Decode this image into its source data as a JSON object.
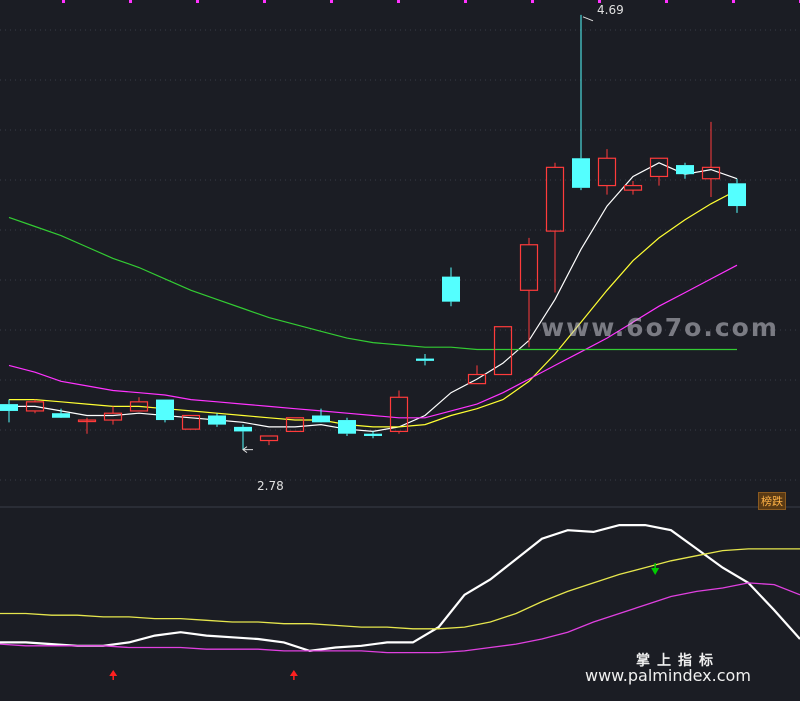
{
  "chart_data": [
    {
      "type": "candlestick",
      "title": "",
      "ylim": [
        2.55,
        4.72
      ],
      "grid": true,
      "annotations": {
        "high_label": "4.69",
        "low_label": "2.78"
      },
      "candles": [
        {
          "o": 2.98,
          "h": 3.0,
          "l": 2.9,
          "c": 2.95
        },
        {
          "o": 2.95,
          "h": 3.0,
          "l": 2.94,
          "c": 2.99
        },
        {
          "o": 2.94,
          "h": 2.96,
          "l": 2.93,
          "c": 2.92
        },
        {
          "o": 2.91,
          "h": 2.92,
          "l": 2.85,
          "c": 2.91
        },
        {
          "o": 2.91,
          "h": 2.97,
          "l": 2.89,
          "c": 2.94
        },
        {
          "o": 2.95,
          "h": 3.01,
          "l": 2.95,
          "c": 2.99
        },
        {
          "o": 3.0,
          "h": 3.0,
          "l": 2.9,
          "c": 2.91
        },
        {
          "o": 2.87,
          "h": 2.93,
          "l": 2.87,
          "c": 2.93
        },
        {
          "o": 2.93,
          "h": 2.94,
          "l": 2.88,
          "c": 2.89
        },
        {
          "o": 2.88,
          "h": 2.89,
          "l": 2.78,
          "c": 2.86
        },
        {
          "o": 2.82,
          "h": 2.84,
          "l": 2.8,
          "c": 2.84
        },
        {
          "o": 2.86,
          "h": 2.92,
          "l": 2.86,
          "c": 2.92
        },
        {
          "o": 2.93,
          "h": 2.96,
          "l": 2.93,
          "c": 2.9
        },
        {
          "o": 2.91,
          "h": 2.92,
          "l": 2.84,
          "c": 2.85
        },
        {
          "o": 2.85,
          "h": 2.86,
          "l": 2.83,
          "c": 2.84
        },
        {
          "o": 2.86,
          "h": 3.04,
          "l": 2.85,
          "c": 3.01
        },
        {
          "o": 3.18,
          "h": 3.2,
          "l": 3.15,
          "c": 3.17
        },
        {
          "o": 3.54,
          "h": 3.58,
          "l": 3.41,
          "c": 3.43
        },
        {
          "o": 3.07,
          "h": 3.15,
          "l": 3.07,
          "c": 3.11
        },
        {
          "o": 3.11,
          "h": 3.32,
          "l": 3.11,
          "c": 3.32
        },
        {
          "o": 3.48,
          "h": 3.71,
          "l": 3.23,
          "c": 3.68
        },
        {
          "o": 3.74,
          "h": 4.04,
          "l": 3.47,
          "c": 4.02
        },
        {
          "o": 4.06,
          "h": 4.69,
          "l": 3.92,
          "c": 3.93
        },
        {
          "o": 3.94,
          "h": 4.1,
          "l": 3.9,
          "c": 4.06
        },
        {
          "o": 3.92,
          "h": 3.96,
          "l": 3.9,
          "c": 3.94
        },
        {
          "o": 3.98,
          "h": 4.06,
          "l": 3.94,
          "c": 4.06
        },
        {
          "o": 4.03,
          "h": 4.04,
          "l": 3.97,
          "c": 3.99
        },
        {
          "o": 3.97,
          "h": 4.22,
          "l": 3.89,
          "c": 4.02
        },
        {
          "o": 3.95,
          "h": 3.97,
          "l": 3.82,
          "c": 3.85
        }
      ],
      "series": [
        {
          "color": "#ffffff",
          "values": [
            2.97,
            2.97,
            2.95,
            2.93,
            2.93,
            2.94,
            2.93,
            2.92,
            2.91,
            2.9,
            2.88,
            2.88,
            2.89,
            2.87,
            2.86,
            2.88,
            2.93,
            3.03,
            3.09,
            3.16,
            3.26,
            3.44,
            3.66,
            3.85,
            3.98,
            4.04,
            3.99,
            4.01,
            3.97
          ]
        },
        {
          "color": "#ffff33",
          "values": [
            3.0,
            3.0,
            2.99,
            2.98,
            2.97,
            2.97,
            2.96,
            2.95,
            2.94,
            2.93,
            2.92,
            2.91,
            2.91,
            2.89,
            2.88,
            2.88,
            2.89,
            2.93,
            2.96,
            3.0,
            3.08,
            3.2,
            3.34,
            3.48,
            3.61,
            3.71,
            3.79,
            3.86,
            3.92
          ]
        },
        {
          "color": "#ff33ff",
          "values": [
            3.15,
            3.12,
            3.08,
            3.06,
            3.04,
            3.03,
            3.02,
            3.0,
            2.99,
            2.98,
            2.97,
            2.96,
            2.95,
            2.94,
            2.93,
            2.92,
            2.92,
            2.95,
            2.98,
            3.03,
            3.09,
            3.15,
            3.21,
            3.27,
            3.34,
            3.41,
            3.47,
            3.53,
            3.59
          ]
        },
        {
          "color": "#33cc33",
          "values": [
            3.8,
            3.76,
            3.72,
            3.67,
            3.62,
            3.58,
            3.53,
            3.48,
            3.44,
            3.4,
            3.36,
            3.33,
            3.3,
            3.27,
            3.25,
            3.24,
            3.23,
            3.23,
            3.22,
            3.22,
            3.22,
            3.22,
            3.22,
            3.22,
            3.22,
            3.22,
            3.22,
            3.22,
            3.22
          ]
        }
      ]
    },
    {
      "type": "line",
      "title": "",
      "ylim": [
        0,
        100
      ],
      "series": [
        {
          "color": "#ffffff",
          "values": [
            28,
            28,
            27,
            26,
            26,
            28,
            32,
            34,
            32,
            31,
            30,
            28,
            23,
            25,
            26,
            28,
            28,
            37,
            56,
            65,
            77,
            89,
            94,
            93,
            97,
            97,
            94,
            83,
            72,
            63,
            47,
            30
          ]
        },
        {
          "color": "#e6e64d",
          "values": [
            45,
            45,
            44,
            44,
            43,
            43,
            42,
            42,
            41,
            40,
            40,
            39,
            39,
            38,
            37,
            37,
            36,
            36,
            37,
            40,
            45,
            52,
            58,
            63,
            68,
            72,
            76,
            79,
            82,
            83,
            83,
            83
          ]
        },
        {
          "color": "#e040e0",
          "values": [
            27,
            26,
            26,
            26,
            26,
            25,
            25,
            25,
            24,
            24,
            24,
            23,
            23,
            23,
            23,
            22,
            22,
            22,
            23,
            25,
            27,
            30,
            34,
            40,
            45,
            50,
            55,
            58,
            60,
            63,
            62,
            56
          ]
        }
      ],
      "markers": [
        {
          "index": 4,
          "direction": "up",
          "color": "#ff2020"
        },
        {
          "index": 11,
          "direction": "up",
          "color": "#ff2020"
        },
        {
          "index": 25,
          "direction": "down",
          "color": "#00cc00"
        }
      ]
    }
  ],
  "badge": {
    "text": "榜跌"
  },
  "watermarks": {
    "top": "www.6o7o.com",
    "cn": "掌上指标",
    "url": "www.palmindex.com"
  }
}
